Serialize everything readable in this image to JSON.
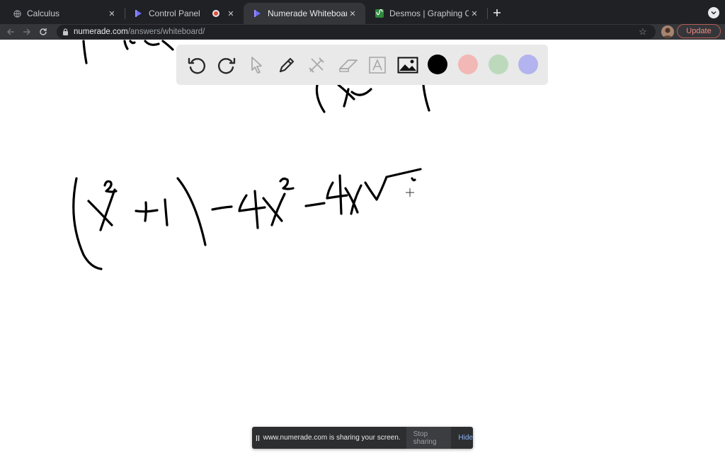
{
  "browser": {
    "tabs": [
      {
        "title": "Calculus",
        "icon": "globe-icon",
        "active": false
      },
      {
        "title": "Control Panel",
        "icon": "numerade-icon",
        "active": false,
        "recording": true
      },
      {
        "title": "Numerade Whiteboard",
        "icon": "numerade-icon",
        "active": true
      },
      {
        "title": "Desmos | Graphing Calculator",
        "icon": "desmos-icon",
        "active": false
      }
    ],
    "address": {
      "host": "numerade.com",
      "path": "/answers/whiteboard/"
    },
    "update_label": "Update"
  },
  "whiteboard": {
    "tools": [
      "undo",
      "redo",
      "select",
      "pen",
      "shapes",
      "eraser",
      "text",
      "image"
    ],
    "colors": [
      "#000000",
      "#f2b8b5",
      "#bcd9bc",
      "#b3b3ef"
    ]
  },
  "sharebar": {
    "message": "www.numerade.com is sharing your screen.",
    "stop_label": "Stop sharing",
    "hide_label": "Hide"
  }
}
